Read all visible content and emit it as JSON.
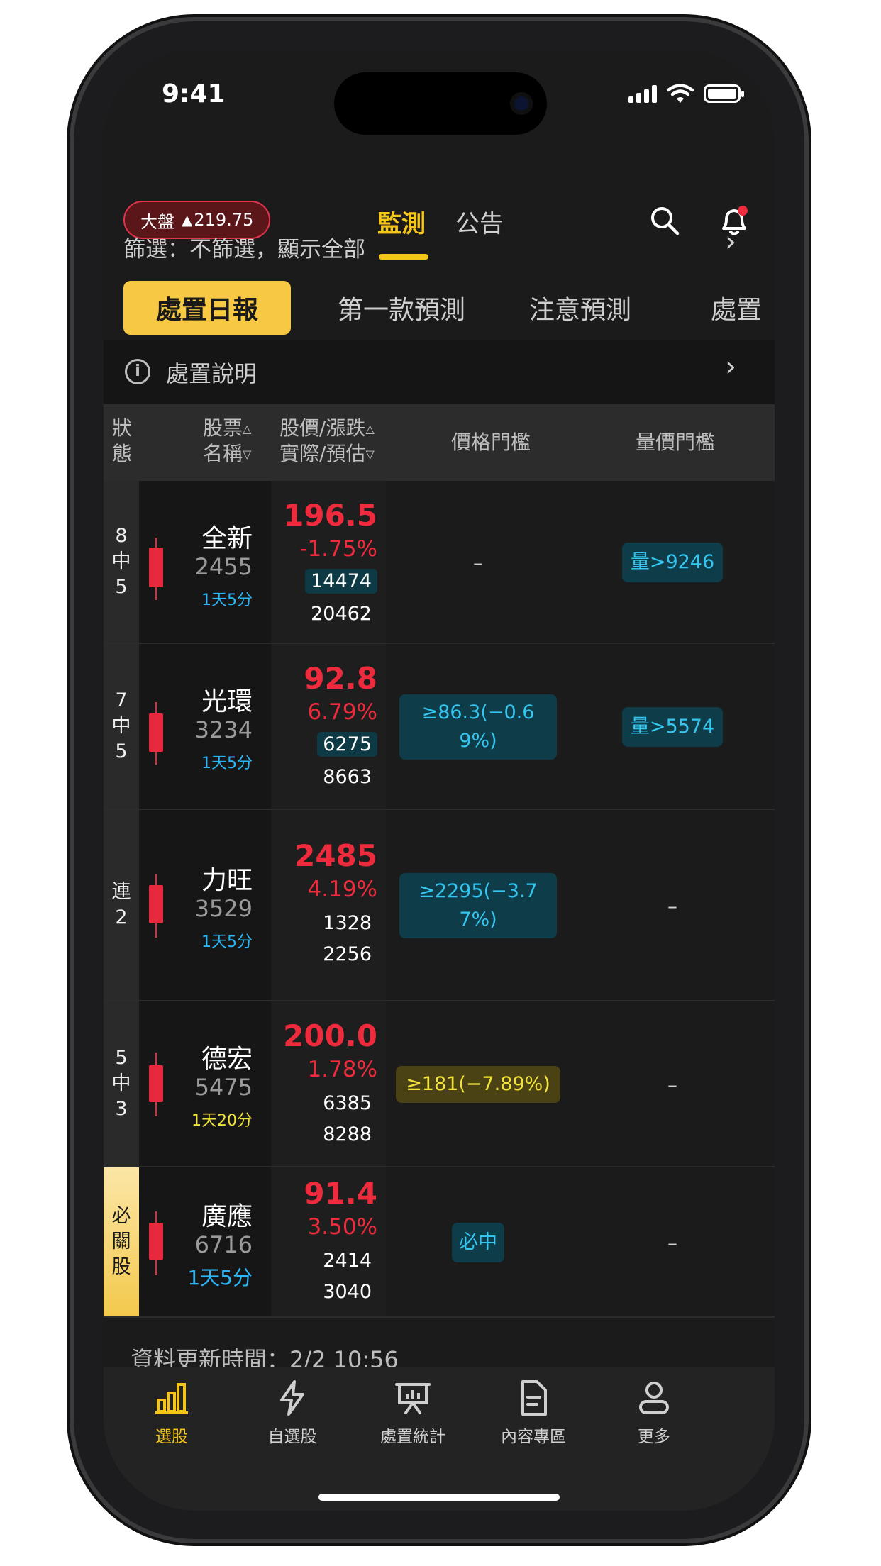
{
  "status_bar": {
    "time": "9:41"
  },
  "header": {
    "market_label": "大盤",
    "market_arrow": "▲",
    "market_value": "219.75",
    "tabs": [
      {
        "label": "監測",
        "active": true
      },
      {
        "label": "公告",
        "active": false
      }
    ]
  },
  "filter": {
    "text": "篩選：不篩選，顯示全部"
  },
  "subtabs": [
    "處置日報",
    "第一款預測",
    "注意預測",
    "處置"
  ],
  "explain": {
    "text": "處置說明"
  },
  "table": {
    "headers": {
      "status": "狀態",
      "stock_line1": "股票",
      "stock_line2": "名稱",
      "price_line1": "股價/漲跌",
      "price_line2": "實際/預估",
      "price_threshold": "價格門檻",
      "volume_threshold": "量價門檻"
    },
    "rows": [
      {
        "status": "8中5",
        "name": "全新",
        "code": "2455",
        "duration": "1天5分",
        "duration_color": "#29b6f6",
        "price": "196.5",
        "change": "-1.75%",
        "vol_actual": "14474",
        "vol_est": "20462",
        "price_threshold": "–",
        "volume_threshold": "量>9246"
      },
      {
        "status": "7中5",
        "name": "光環",
        "code": "3234",
        "duration": "1天5分",
        "duration_color": "#29b6f6",
        "price": "92.8",
        "change": "6.79%",
        "vol_actual": "6275",
        "vol_est": "8663",
        "price_threshold_l1": "≥86.3(−0.6",
        "price_threshold_l2": "9%)",
        "volume_threshold": "量>5574"
      },
      {
        "status": "連2",
        "name": "力旺",
        "code": "3529",
        "duration": "1天5分",
        "duration_color": "#29b6f6",
        "price": "2485",
        "change": "4.19%",
        "vol_actual": "1328",
        "vol_est": "2256",
        "price_threshold_l1": "≥2295(−3.7",
        "price_threshold_l2": "7%)",
        "volume_threshold": "–"
      },
      {
        "status": "5中3",
        "name": "德宏",
        "code": "5475",
        "duration": "1天20分",
        "duration_color": "#f2e33c",
        "price": "200.0",
        "change": "1.78%",
        "vol_actual": "6385",
        "vol_est": "8288",
        "price_threshold": "≥181(−7.89%)",
        "volume_threshold": "–"
      },
      {
        "status": "必關股",
        "name": "廣應",
        "code": "6716",
        "duration": "1天5分",
        "duration_color": "#29b6f6",
        "price": "91.4",
        "change": "3.50%",
        "vol_actual": "2414",
        "vol_est": "3040",
        "price_threshold": "必中",
        "volume_threshold": "–"
      }
    ]
  },
  "update": {
    "text": "資料更新時間：2/2 10:56"
  },
  "tabbar": [
    {
      "label": "選股",
      "icon": "bar-chart-icon",
      "active": true
    },
    {
      "label": "自選股",
      "icon": "lightning-icon",
      "active": false
    },
    {
      "label": "處置統計",
      "icon": "presentation-icon",
      "active": false
    },
    {
      "label": "內容專區",
      "icon": "document-icon",
      "active": false
    },
    {
      "label": "更多",
      "icon": "person-icon",
      "active": false
    }
  ],
  "colors": {
    "accent": "#f5c518",
    "up": "#ee2b3c",
    "cyan": "#35c6f0"
  }
}
